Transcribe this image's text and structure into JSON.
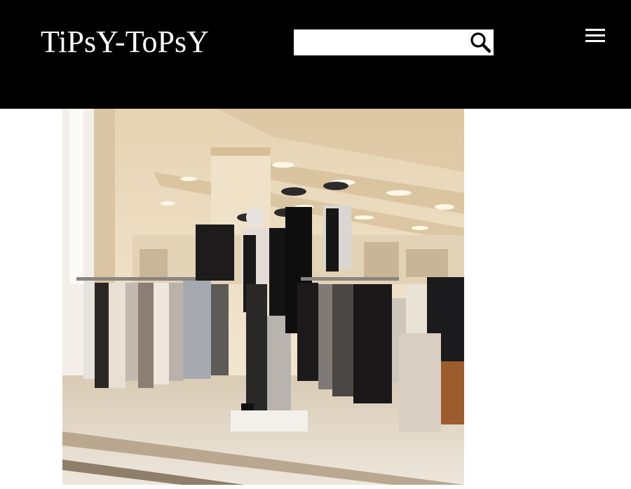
{
  "header": {
    "logo_text": "TiPsY-ToPsY",
    "background_color": "#000000",
    "text_color": "#ffffff"
  },
  "search": {
    "value": "",
    "placeholder": "",
    "icon": "search-icon"
  },
  "menu": {
    "icon": "hamburger-menu-icon"
  },
  "hero": {
    "image_subject": "clothing-store-interior-with-mannequins"
  }
}
